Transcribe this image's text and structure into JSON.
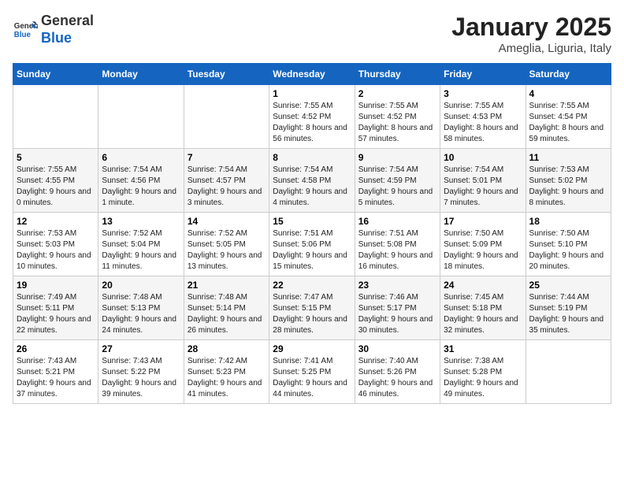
{
  "header": {
    "logo_general": "General",
    "logo_blue": "Blue",
    "title": "January 2025",
    "subtitle": "Ameglia, Liguria, Italy"
  },
  "days_of_week": [
    "Sunday",
    "Monday",
    "Tuesday",
    "Wednesday",
    "Thursday",
    "Friday",
    "Saturday"
  ],
  "weeks": [
    [
      {
        "day": "",
        "info": ""
      },
      {
        "day": "",
        "info": ""
      },
      {
        "day": "",
        "info": ""
      },
      {
        "day": "1",
        "info": "Sunrise: 7:55 AM\nSunset: 4:52 PM\nDaylight: 8 hours and 56 minutes."
      },
      {
        "day": "2",
        "info": "Sunrise: 7:55 AM\nSunset: 4:52 PM\nDaylight: 8 hours and 57 minutes."
      },
      {
        "day": "3",
        "info": "Sunrise: 7:55 AM\nSunset: 4:53 PM\nDaylight: 8 hours and 58 minutes."
      },
      {
        "day": "4",
        "info": "Sunrise: 7:55 AM\nSunset: 4:54 PM\nDaylight: 8 hours and 59 minutes."
      }
    ],
    [
      {
        "day": "5",
        "info": "Sunrise: 7:55 AM\nSunset: 4:55 PM\nDaylight: 9 hours and 0 minutes."
      },
      {
        "day": "6",
        "info": "Sunrise: 7:54 AM\nSunset: 4:56 PM\nDaylight: 9 hours and 1 minute."
      },
      {
        "day": "7",
        "info": "Sunrise: 7:54 AM\nSunset: 4:57 PM\nDaylight: 9 hours and 3 minutes."
      },
      {
        "day": "8",
        "info": "Sunrise: 7:54 AM\nSunset: 4:58 PM\nDaylight: 9 hours and 4 minutes."
      },
      {
        "day": "9",
        "info": "Sunrise: 7:54 AM\nSunset: 4:59 PM\nDaylight: 9 hours and 5 minutes."
      },
      {
        "day": "10",
        "info": "Sunrise: 7:54 AM\nSunset: 5:01 PM\nDaylight: 9 hours and 7 minutes."
      },
      {
        "day": "11",
        "info": "Sunrise: 7:53 AM\nSunset: 5:02 PM\nDaylight: 9 hours and 8 minutes."
      }
    ],
    [
      {
        "day": "12",
        "info": "Sunrise: 7:53 AM\nSunset: 5:03 PM\nDaylight: 9 hours and 10 minutes."
      },
      {
        "day": "13",
        "info": "Sunrise: 7:52 AM\nSunset: 5:04 PM\nDaylight: 9 hours and 11 minutes."
      },
      {
        "day": "14",
        "info": "Sunrise: 7:52 AM\nSunset: 5:05 PM\nDaylight: 9 hours and 13 minutes."
      },
      {
        "day": "15",
        "info": "Sunrise: 7:51 AM\nSunset: 5:06 PM\nDaylight: 9 hours and 15 minutes."
      },
      {
        "day": "16",
        "info": "Sunrise: 7:51 AM\nSunset: 5:08 PM\nDaylight: 9 hours and 16 minutes."
      },
      {
        "day": "17",
        "info": "Sunrise: 7:50 AM\nSunset: 5:09 PM\nDaylight: 9 hours and 18 minutes."
      },
      {
        "day": "18",
        "info": "Sunrise: 7:50 AM\nSunset: 5:10 PM\nDaylight: 9 hours and 20 minutes."
      }
    ],
    [
      {
        "day": "19",
        "info": "Sunrise: 7:49 AM\nSunset: 5:11 PM\nDaylight: 9 hours and 22 minutes."
      },
      {
        "day": "20",
        "info": "Sunrise: 7:48 AM\nSunset: 5:13 PM\nDaylight: 9 hours and 24 minutes."
      },
      {
        "day": "21",
        "info": "Sunrise: 7:48 AM\nSunset: 5:14 PM\nDaylight: 9 hours and 26 minutes."
      },
      {
        "day": "22",
        "info": "Sunrise: 7:47 AM\nSunset: 5:15 PM\nDaylight: 9 hours and 28 minutes."
      },
      {
        "day": "23",
        "info": "Sunrise: 7:46 AM\nSunset: 5:17 PM\nDaylight: 9 hours and 30 minutes."
      },
      {
        "day": "24",
        "info": "Sunrise: 7:45 AM\nSunset: 5:18 PM\nDaylight: 9 hours and 32 minutes."
      },
      {
        "day": "25",
        "info": "Sunrise: 7:44 AM\nSunset: 5:19 PM\nDaylight: 9 hours and 35 minutes."
      }
    ],
    [
      {
        "day": "26",
        "info": "Sunrise: 7:43 AM\nSunset: 5:21 PM\nDaylight: 9 hours and 37 minutes."
      },
      {
        "day": "27",
        "info": "Sunrise: 7:43 AM\nSunset: 5:22 PM\nDaylight: 9 hours and 39 minutes."
      },
      {
        "day": "28",
        "info": "Sunrise: 7:42 AM\nSunset: 5:23 PM\nDaylight: 9 hours and 41 minutes."
      },
      {
        "day": "29",
        "info": "Sunrise: 7:41 AM\nSunset: 5:25 PM\nDaylight: 9 hours and 44 minutes."
      },
      {
        "day": "30",
        "info": "Sunrise: 7:40 AM\nSunset: 5:26 PM\nDaylight: 9 hours and 46 minutes."
      },
      {
        "day": "31",
        "info": "Sunrise: 7:38 AM\nSunset: 5:28 PM\nDaylight: 9 hours and 49 minutes."
      },
      {
        "day": "",
        "info": ""
      }
    ]
  ]
}
